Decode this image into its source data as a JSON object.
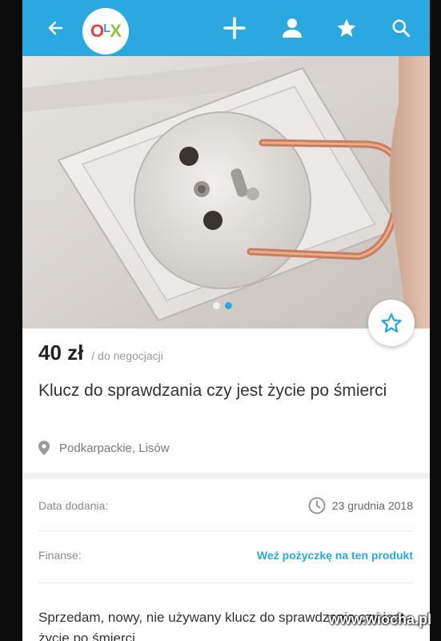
{
  "appbar": {
    "logo": {
      "o": "O",
      "l": "L",
      "x": "X"
    },
    "icons": [
      "back-arrow-icon",
      "plus-icon",
      "user-icon",
      "star-icon",
      "search-icon"
    ],
    "color": "#2aa8e0"
  },
  "gallery": {
    "count": 2,
    "active_index": 1
  },
  "listing": {
    "price": "40 zł",
    "negotiable": "/ do negocjacji",
    "title": "Klucz do sprawdzania czy jest życie po śmierci",
    "location": "Podkarpackie, Lisów"
  },
  "details": {
    "added_label": "Data dodania:",
    "added_value": "23 grudnia 2018",
    "finance_label": "Finanse:",
    "finance_link": "Weź pożyczkę na ten produkt"
  },
  "description": "Sprzedam, nowy, nie używany klucz do sprawdzania czy jest życie po śmierci",
  "watermark": "www.wiocha.pl"
}
